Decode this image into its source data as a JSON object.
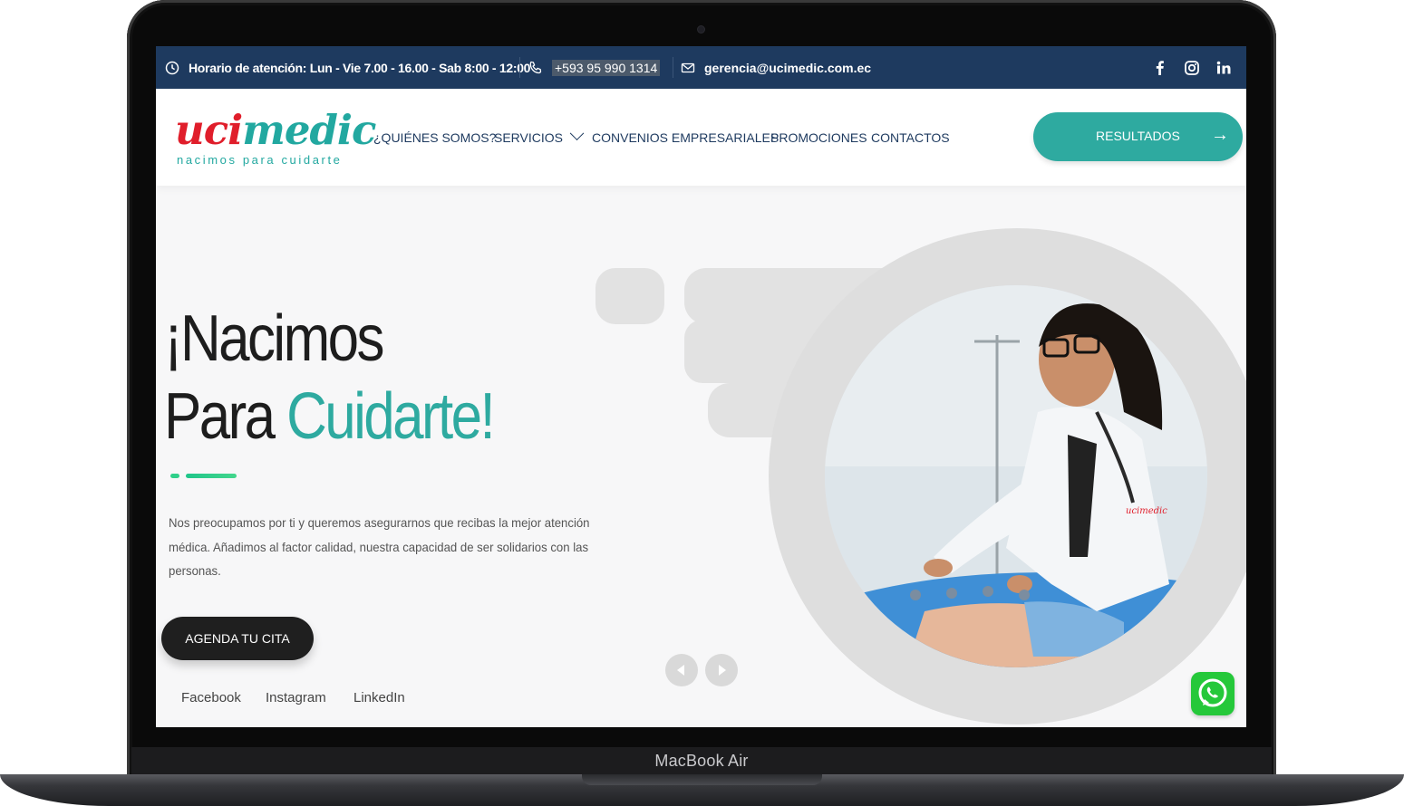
{
  "device": {
    "label": "MacBook Air"
  },
  "topbar": {
    "hours": "Horario de atención: Lun - Vie 7.00 - 16.00 - Sab 8:00 - 12:00",
    "phone": "+593 95 990 1314",
    "email": "gerencia@ucimedic.com.ec",
    "social_icons": [
      "facebook-icon",
      "instagram-icon",
      "linkedin-icon"
    ]
  },
  "header": {
    "logo_part1": "uci",
    "logo_part2": "medic",
    "logo_tagline": "nacimos para cuidarte",
    "nav": {
      "about": "¿QUIÉNES SOMOS?",
      "services": "SERVICIOS",
      "agreements": "CONVENIOS EMPRESARIALES",
      "promotions": "PROMOCIONES",
      "contacts": "CONTACTOS"
    },
    "results_button": "RESULTADOS"
  },
  "hero": {
    "title_line1": "¡Nacimos",
    "title_line2_a": "Para ",
    "title_line2_b": "Cuidarte!",
    "description": "Nos preocupamos por ti y queremos asegurarnos que recibas la mejor atención médica. Añadimos al factor calidad, nuestra capacidad de ser solidarios con las personas.",
    "cta": "AGENDA TU CITA",
    "links": {
      "facebook": "Facebook",
      "instagram": "Instagram",
      "linkedin": "LinkedIn"
    },
    "photo_badge": "ucimedic"
  },
  "colors": {
    "topbar_bg": "#1e3a5f",
    "accent_teal": "#2eaaa0",
    "brand_red": "#e01e2b",
    "cta_bg": "#1f1f1f",
    "whatsapp": "#25c83a"
  }
}
